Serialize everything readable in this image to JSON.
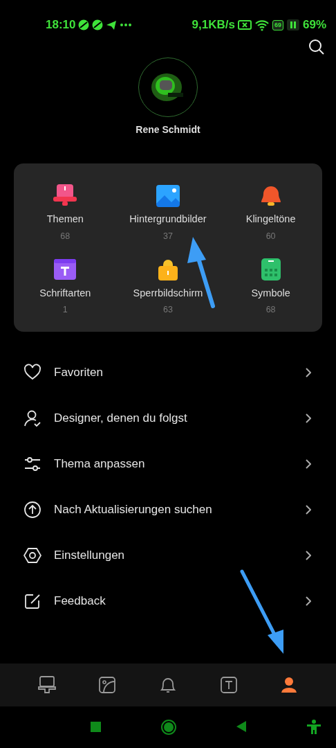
{
  "status_bar": {
    "time": "18:10",
    "speed": "9,1KB/s",
    "battery_box": "69",
    "battery": "69%"
  },
  "profile": {
    "name": "Rene Schmidt"
  },
  "categories": [
    {
      "kind": "themes",
      "label": "Themen",
      "count": "68"
    },
    {
      "kind": "wallpapers",
      "label": "Hintergrundbilder",
      "count": "37"
    },
    {
      "kind": "ringtones",
      "label": "Klingeltöne",
      "count": "60"
    },
    {
      "kind": "fonts",
      "label": "Schriftarten",
      "count": "1"
    },
    {
      "kind": "lockscreen",
      "label": "Sperrbildschirm",
      "count": "63"
    },
    {
      "kind": "icons",
      "label": "Symbole",
      "count": "68"
    }
  ],
  "menu": [
    {
      "kind": "heart",
      "label": "Favoriten"
    },
    {
      "kind": "person",
      "label": "Designer, denen du folgst"
    },
    {
      "kind": "sliders",
      "label": "Thema anpassen"
    },
    {
      "kind": "update",
      "label": "Nach Aktualisierungen suchen"
    },
    {
      "kind": "settings",
      "label": "Einstellungen"
    },
    {
      "kind": "feedback",
      "label": "Feedback"
    }
  ],
  "bottom_nav": [
    {
      "kind": "themes",
      "selected": false
    },
    {
      "kind": "wallpapers",
      "selected": false
    },
    {
      "kind": "ringtones",
      "selected": false
    },
    {
      "kind": "fonts",
      "selected": false
    },
    {
      "kind": "profile",
      "selected": true
    }
  ]
}
